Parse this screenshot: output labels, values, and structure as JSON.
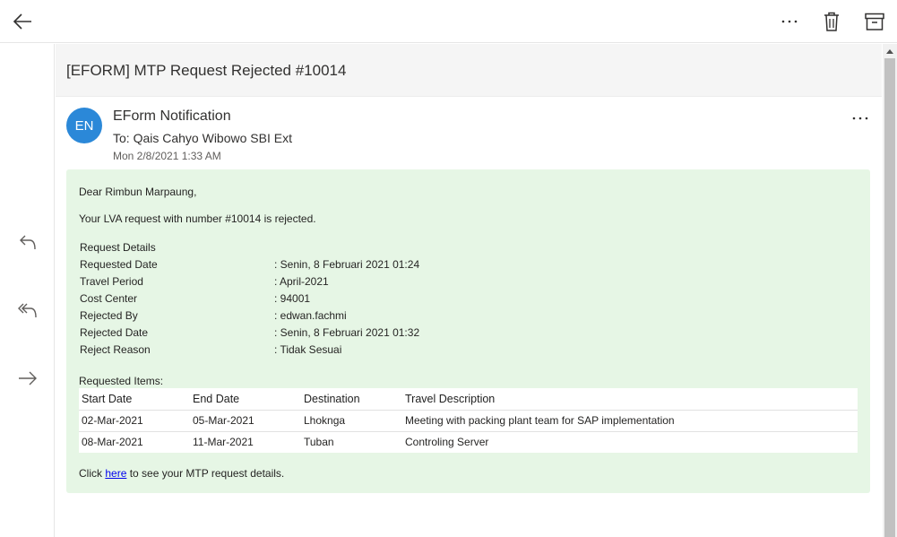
{
  "toolbar": {
    "back_icon": "arrow-left-icon",
    "more_icon": "ellipsis-icon",
    "more_label": "⋯",
    "delete_icon": "trash-icon",
    "archive_icon": "archive-icon"
  },
  "rail": {
    "reply_icon": "reply-icon",
    "reply_all_icon": "reply-all-icon",
    "forward_icon": "forward-icon"
  },
  "email": {
    "subject": "[EFORM] MTP Request Rejected #10014",
    "avatar_initials": "EN",
    "avatar_color": "#2b88d8",
    "sender": "EForm Notification",
    "to": "To: Qais Cahyo Wibowo SBI Ext",
    "date": "Mon 2/8/2021 1:33 AM",
    "more_label": "⋯",
    "body_bg": "#e6f6e5",
    "greeting": "Dear Rimbun Marpaung,",
    "rejected_text": "Your LVA request with number #10014 is rejected.",
    "details_title": "Request Details",
    "details": [
      {
        "label": "Requested Date",
        "value": ": Senin, 8 Februari 2021 01:24"
      },
      {
        "label": "Travel Period",
        "value": ": April-2021"
      },
      {
        "label": "Cost Center",
        "value": ": 94001"
      },
      {
        "label": "Rejected By",
        "value": ": edwan.fachmi"
      },
      {
        "label": "Rejected Date",
        "value": ": Senin, 8 Februari 2021 01:32"
      },
      {
        "label": "Reject Reason",
        "value": ": Tidak Sesuai"
      }
    ],
    "items_title": "Requested Items:",
    "items_columns": [
      "Start Date",
      "End Date",
      "Destination",
      "Travel Description"
    ],
    "items_rows": [
      [
        "02-Mar-2021",
        "05-Mar-2021",
        "Lhoknga",
        "Meeting with packing plant team for SAP implementation"
      ],
      [
        "08-Mar-2021",
        "11-Mar-2021",
        "Tuban",
        "Controling Server"
      ]
    ],
    "click_prefix": "Click ",
    "click_link": "here",
    "click_suffix": " to see your MTP request details."
  }
}
